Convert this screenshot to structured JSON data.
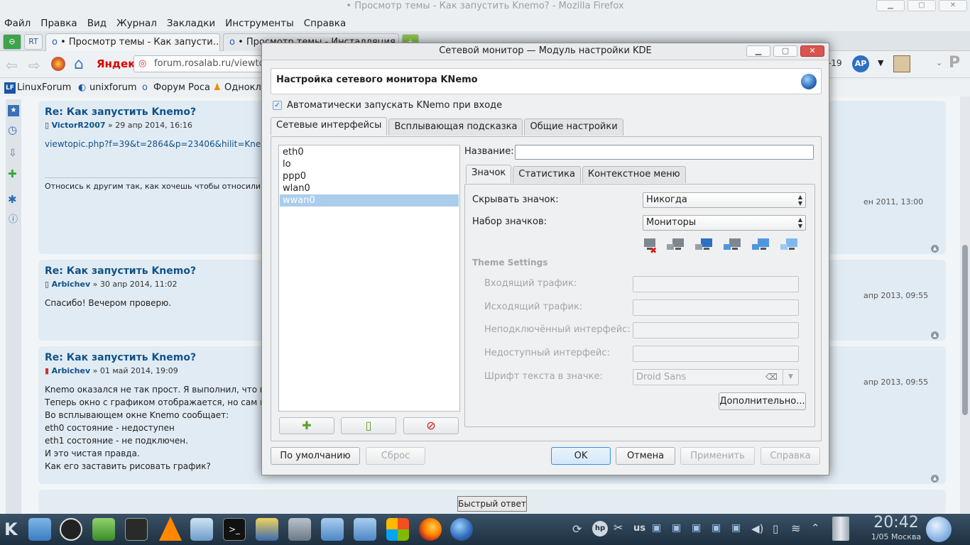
{
  "firefox": {
    "window_title": "• Просмотр темы - Как запустить Knemo? - Mozilla Firefox",
    "menu": [
      "Файл",
      "Правка",
      "Вид",
      "Журнал",
      "Закладки",
      "Инструменты",
      "Справка"
    ],
    "tabs": [
      {
        "label": "• Просмотр темы - Как запусти…"
      },
      {
        "label": "• Просмотр темы - Инсталляция…"
      }
    ],
    "url": "forum.rosalab.ru/viewtop",
    "yandex_label": "Яндекс",
    "nav_right_text": "-19",
    "bookmarks": [
      "LinuxForum",
      "unixforum",
      "Форум Роса",
      "Однокла"
    ]
  },
  "posts": [
    {
      "title": "Re: Как запустить Knemo?",
      "author": "VictorR2007",
      "date": " » 29 апр 2014, 16:16",
      "lines": [
        "viewtopic.php?f=39&t=2864&p=23406&hilit=Knemo#"
      ],
      "signature": "Относись к другим так, как хочешь чтобы относили",
      "right_meta": "ен 2011, 13:00"
    },
    {
      "title": "Re: Как запустить Knemo?",
      "author": "Arbichev",
      "date": " » 30 апр 2014, 11:02",
      "lines": [
        "Спасибо! Вечером проверю."
      ],
      "right_meta": "апр 2013, 09:55"
    },
    {
      "title": "Re: Как запустить Knemo?",
      "author": "Arbichev",
      "date": " » 01 май 2014, 19:09",
      "lines": [
        "Knemo оказался не так прост. Я выполнил, что мн",
        "Теперь окно с графиком отображается, но сам гра",
        "Во всплывающем окне Knemo сообщает:",
        "eth0 состояние - недоступен",
        "eth1 состояние - не подключен.",
        "И это чистая правда.",
        "Как его заставить рисовать график?"
      ],
      "right_meta": "апр 2013, 09:55"
    }
  ],
  "quick_reply": "Быстрый ответ",
  "dialog": {
    "title": "Сетевой монитор — Модуль настройки KDE",
    "header": "Настройка сетевого монитора KNemo",
    "autostart_label": "Автоматически запускать KNemo при входе",
    "autostart_checked": true,
    "tabs": [
      "Сетевые интерфейсы",
      "Всплывающая подсказка",
      "Общие настройки"
    ],
    "interfaces": [
      "eth0",
      "lo",
      "ppp0",
      "wlan0",
      "wwan0"
    ],
    "selected_interface": "wwan0",
    "name_label": "Название:",
    "name_value": "",
    "inner_tabs": [
      "Значок",
      "Статистика",
      "Контекстное меню"
    ],
    "hide_icon_label": "Скрывать значок:",
    "hide_icon_value": "Никогда",
    "icon_set_label": "Набор значков:",
    "icon_set_value": "Мониторы",
    "theme_settings": "Theme Settings",
    "theme_rows": [
      "Входящий трафик:",
      "Исходящий трафик:",
      "Неподключённый интерфейс:",
      "Недоступный интерфейс:",
      "Шрифт текста в значке:"
    ],
    "font_value": "Droid Sans",
    "advanced_button": "Дополнительно...",
    "buttons": {
      "defaults": "По умолчанию",
      "reset": "Сброс",
      "ok": "OK",
      "cancel": "Отмена",
      "apply": "Применить",
      "help": "Справка"
    }
  },
  "taskbar": {
    "layout": "us",
    "time": "20:42",
    "date": "1/05 Москва"
  }
}
